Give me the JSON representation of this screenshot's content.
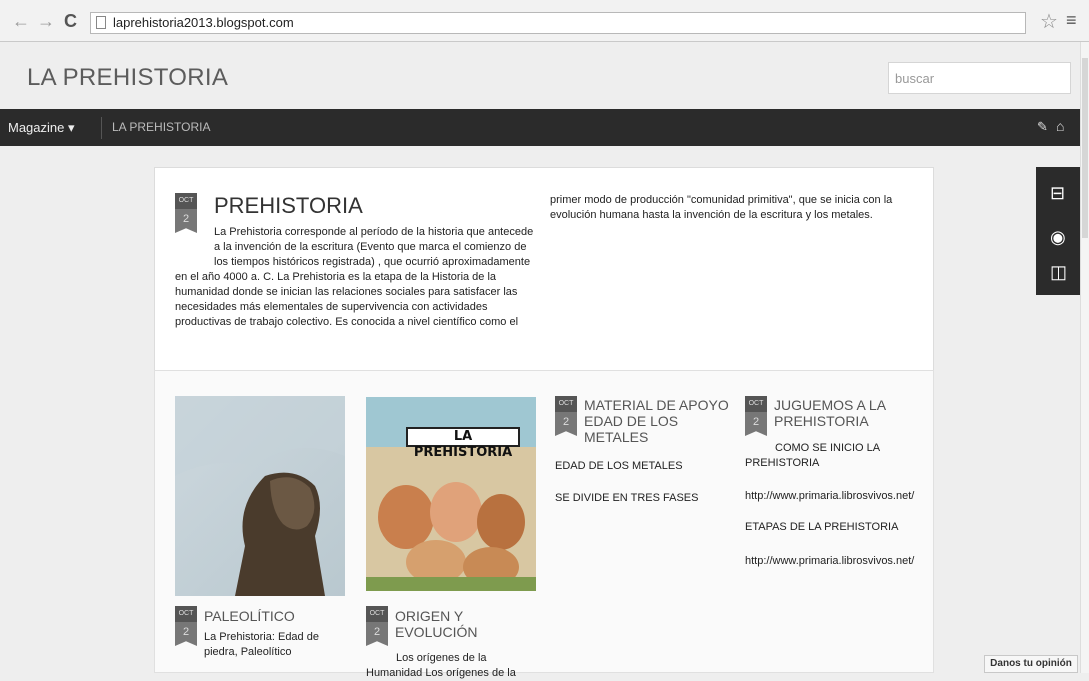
{
  "browser": {
    "url": "laprehistoria2013.blogspot.com"
  },
  "header": {
    "title": "LA PREHISTORIA",
    "search_placeholder": "buscar"
  },
  "navbar": {
    "menu_label": "Magazine",
    "current": "LA PREHISTORIA"
  },
  "featured": {
    "month": "OCT",
    "day": "2",
    "title": "PREHISTORIA",
    "body_indent": "La Prehistoria corresponde al período de la historia que antecede a la invención de la escritura (Evento que marca el comienzo de los tiempos históricos registrada) , que ocurrió aproximadamente",
    "body": "en el año 4000 a. C. La Prehistoria es la etapa de la Historia de la humanidad donde se inician las relaciones sociales para satisfacer las necesidades más elementales de supervivencia con actividades productivas de trabajo colectivo. Es conocida a nivel científico como el",
    "body_col2": "primer modo de producción \"comunidad primitiva\", que se inicia con la evolución humana hasta la invención de la escritura y los metales."
  },
  "posts": [
    {
      "month": "OCT",
      "day": "2",
      "title": "PALEOLÍTICO",
      "text": "La Prehistoria: Edad de piedra, Paleolítico"
    },
    {
      "month": "OCT",
      "day": "2",
      "title": "ORIGEN Y EVOLUCIÓN",
      "text": "Los orígenes de la Humanidad Los orígenes de la",
      "image_label": "LA PREHISTORIA"
    },
    {
      "month": "OCT",
      "day": "2",
      "title": "MATERIAL DE APOYO EDAD DE LOS METALES",
      "lines": [
        "EDAD DE LOS METALES",
        "SE DIVIDE EN TRES FASES"
      ]
    },
    {
      "month": "OCT",
      "day": "2",
      "title": "JUGUEMOS A LA PREHISTORIA",
      "lines": [
        "COMO SE INICIO LA PREHISTORIA",
        "http://www.primaria.librosvivos.net/",
        "ETAPAS DE LA PREHISTORIA",
        "http://www.primaria.librosvivos.net/"
      ]
    }
  ],
  "feedback_label": "Danos tu opinión"
}
